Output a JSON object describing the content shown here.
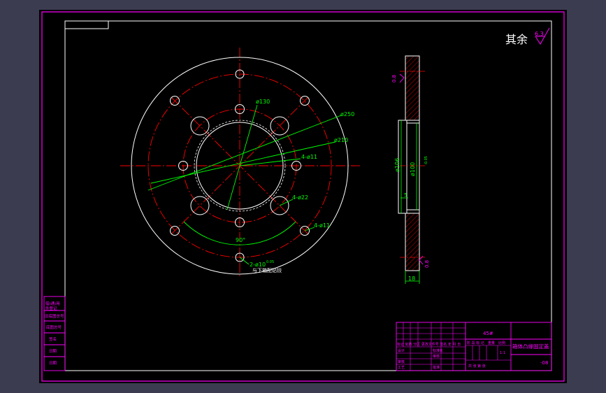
{
  "roughness_note": {
    "prefix": "其余",
    "value": "6.3"
  },
  "dimensions_front": {
    "d130": "ø130",
    "d250": "ø250",
    "d210": "ø210",
    "holes11a": "4-ø11",
    "holes22": "4-ø22",
    "holes11b": "4-ø11",
    "angle": "90°",
    "pins": "2-ø10",
    "pins_tol": "0.05",
    "pins_note": "与下箱配钻铰"
  },
  "dimensions_side": {
    "roughness_top": "0.8",
    "d106": "ø106",
    "d100": "ø100",
    "d100_tol": "-0.05",
    "step": "5",
    "roughness_bottom": "0.8",
    "width": "18"
  },
  "left_stamp": [
    "借(通)用",
    "件登记",
    "旧底图总号",
    "底图总号",
    "签名",
    "日期",
    "日期"
  ],
  "title_block": {
    "material": "45#",
    "part_name": "箱体凸缘固定盖",
    "drawing_no": "-08",
    "header_row": "标记 处数 分区 更改文件号 签名 年 月 日",
    "design": "设计",
    "standardize": "标准化",
    "review": "审核",
    "process": "工艺",
    "approve": "批准",
    "stage_label": "阶 段 标 记",
    "weight": "重量",
    "scale": "比例",
    "scale_value": "1:1",
    "sheets": "共 张 第 张",
    "check": "审核"
  }
}
